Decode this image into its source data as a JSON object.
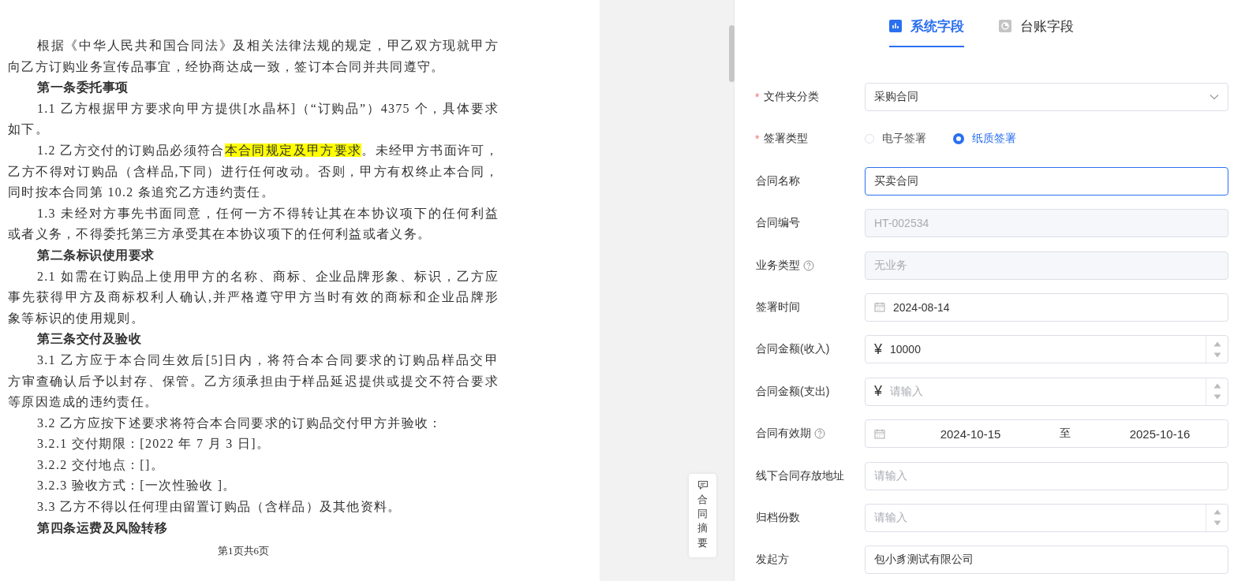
{
  "document": {
    "paragraphs": [
      {
        "kind": "body",
        "lines": [
          "根据《中华人民共和国合同法》及相关法律法规的规定，甲乙双方现就甲方",
          "向乙方订购业务宣传品事宜，经协商达成一致，签订本合同并共同遵守。"
        ]
      },
      {
        "kind": "heading",
        "lines": [
          "第一条委托事项"
        ]
      },
      {
        "kind": "body",
        "lines": [
          "1.1 乙方根据甲方要求向甲方提供[水晶杯]（“订购品”）4375 个，具体要求",
          "如下。"
        ]
      },
      {
        "kind": "body",
        "lines": [
          [
            {
              "text": "1.2 乙方交付的订购品必须符合",
              "highlighted": false
            },
            {
              "text": "本合同规定及甲方要求",
              "highlighted": true
            },
            {
              "text": "。未经甲方书面许可，",
              "highlighted": false
            }
          ],
          "乙方不得对订购品（含样品,下同）进行任何改动。否则，甲方有权终止本合同，",
          "同时按本合同第 10.2 条追究乙方违约责任。"
        ]
      },
      {
        "kind": "body",
        "lines": [
          "1.3 未经对方事先书面同意，任何一方不得转让其在本协议项下的任何利益",
          "或者义务，不得委托第三方承受其在本协议项下的任何利益或者义务。"
        ]
      },
      {
        "kind": "heading",
        "lines": [
          "第二条标识使用要求"
        ]
      },
      {
        "kind": "body",
        "lines": [
          "2.1 如需在订购品上使用甲方的名称、商标、企业品牌形象、标识，乙方应",
          "事先获得甲方及商标权利人确认,并严格遵守甲方当时有效的商标和企业品牌形",
          "象等标识的使用规则。"
        ]
      },
      {
        "kind": "heading",
        "lines": [
          "第三条交付及验收"
        ]
      },
      {
        "kind": "body",
        "lines": [
          "3.1  乙方应于本合同生效后[5]日内，将符合本合同要求的订购品样品交甲",
          "方审查确认后予以封存、保管。乙方须承担由于样品延迟提供或提交不符合要求",
          "等原因造成的违约责任。"
        ]
      },
      {
        "kind": "body",
        "lines": [
          "3.2 乙方应按下述要求将符合本合同要求的订购品交付甲方并验收："
        ]
      },
      {
        "kind": "body",
        "lines": [
          "3.2.1 交付期限：[2022 年 7 月 3 日]。"
        ]
      },
      {
        "kind": "body",
        "lines": [
          "3.2.2 交付地点：[]。"
        ]
      },
      {
        "kind": "body",
        "lines": [
          "3.2.3 验收方式：[一次性验收 ]。"
        ]
      },
      {
        "kind": "body",
        "lines": [
          "3.3 乙方不得以任何理由留置订购品（含样品）及其他资料。"
        ]
      },
      {
        "kind": "heading",
        "lines": [
          "第四条运费及风险转移"
        ]
      }
    ],
    "page_footer": "第1页共6页"
  },
  "summary_button": {
    "label": "合同摘要"
  },
  "tabs": [
    {
      "label": "系统字段",
      "selected": true,
      "kind": "chart"
    },
    {
      "label": "台账字段",
      "selected": false,
      "kind": "pie"
    }
  ],
  "form": [
    {
      "label": "文件夹分类",
      "required_mark": "*",
      "kind": "select",
      "value": "采购合同"
    },
    {
      "label": "签署类型",
      "required_mark": "*",
      "kind": "radio",
      "options": [
        {
          "label": "电子签署",
          "selected": false
        },
        {
          "label": "纸质签署",
          "selected": true
        }
      ]
    },
    {
      "label": "合同名称",
      "kind": "text",
      "value": "买卖合同",
      "focused": true
    },
    {
      "label": "合同编号",
      "kind": "text",
      "value": "HT-002534",
      "disabled": true
    },
    {
      "label": "业务类型",
      "help": true,
      "kind": "text",
      "value": "无业务",
      "disabled": true
    },
    {
      "label": "签署时间",
      "kind": "date",
      "value": "2024-08-14"
    },
    {
      "label": "合同金额(收入)",
      "kind": "number",
      "currency": "¥",
      "value": "10000"
    },
    {
      "label": "合同金额(支出)",
      "kind": "number",
      "currency": "¥",
      "placeholder": "请输入"
    },
    {
      "label": "合同有效期",
      "help": true,
      "kind": "daterange",
      "start": "2024-10-15",
      "separator": "至",
      "end": "2025-10-16"
    },
    {
      "label": "线下合同存放地址",
      "kind": "text",
      "placeholder": "请输入"
    },
    {
      "label": "归档份数",
      "kind": "number",
      "placeholder": "请输入"
    },
    {
      "label": "发起方",
      "kind": "text",
      "value": "包小豸测试有限公司"
    }
  ]
}
